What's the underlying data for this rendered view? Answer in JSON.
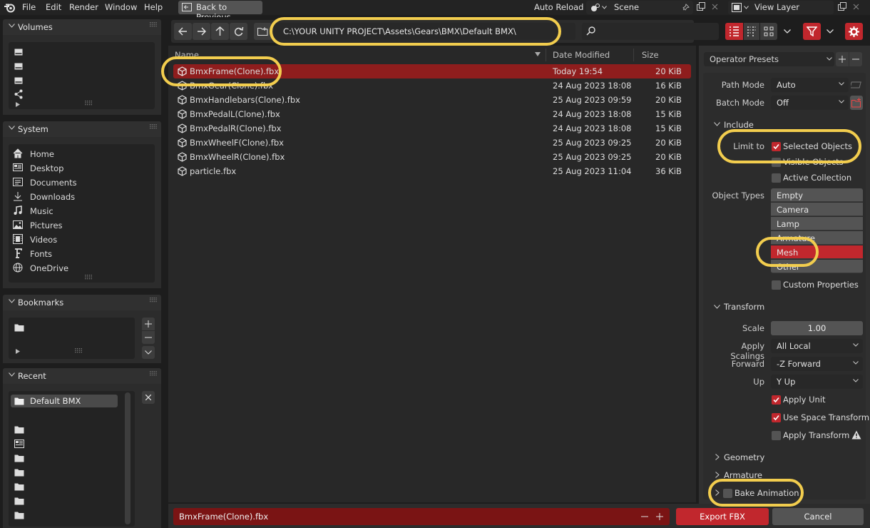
{
  "topbar": {
    "menus": [
      "File",
      "Edit",
      "Render",
      "Window",
      "Help"
    ],
    "back_label": "Back to Previous",
    "auto_reload": "Auto Reload",
    "scene": "Scene",
    "view_layer": "View Layer"
  },
  "sidebar": {
    "volumes_title": "Volumes",
    "system_title": "System",
    "system_items": [
      "Home",
      "Desktop",
      "Documents",
      "Downloads",
      "Music",
      "Pictures",
      "Videos",
      "Fonts",
      "OneDrive"
    ],
    "bookmarks_title": "Bookmarks",
    "recent_title": "Recent",
    "recent_items": [
      "Default BMX"
    ]
  },
  "browser": {
    "path": "C:\\YOUR UNITY PROJECT\\Assets\\Gears\\BMX\\Default BMX\\",
    "search_placeholder": "",
    "columns": {
      "name": "Name",
      "date": "Date Modified",
      "size": "Size"
    },
    "files": [
      {
        "name": "BmxFrame(Clone).fbx",
        "date": "Today 19:54",
        "size": "20 KiB"
      },
      {
        "name": "BmxGear(Clone).fbx",
        "date": "24 Aug 2023 18:08",
        "size": "16 KiB"
      },
      {
        "name": "BmxHandlebars(Clone).fbx",
        "date": "25 Aug 2023 09:59",
        "size": "20 KiB"
      },
      {
        "name": "BmxPedalL(Clone).fbx",
        "date": "24 Aug 2023 18:08",
        "size": "15 KiB"
      },
      {
        "name": "BmxPedalR(Clone).fbx",
        "date": "24 Aug 2023 18:08",
        "size": "15 KiB"
      },
      {
        "name": "BmxWheelF(Clone).fbx",
        "date": "25 Aug 2023 09:25",
        "size": "20 KiB"
      },
      {
        "name": "BmxWheelR(Clone).fbx",
        "date": "25 Aug 2023 09:25",
        "size": "20 KiB"
      },
      {
        "name": "particle.fbx",
        "date": "25 Aug 2023 11:04",
        "size": "36 KiB"
      }
    ],
    "filename": "BmxFrame(Clone).fbx",
    "export_label": "Export FBX",
    "cancel_label": "Cancel"
  },
  "options": {
    "presets": "Operator Presets",
    "path_mode_label": "Path Mode",
    "path_mode": "Auto",
    "batch_mode_label": "Batch Mode",
    "batch_mode": "Off",
    "include_title": "Include",
    "limit_to_label": "Limit to",
    "selected_objects": "Selected Objects",
    "visible_objects": "Visible Objects",
    "active_collection": "Active Collection",
    "object_types_label": "Object Types",
    "object_types": [
      "Empty",
      "Camera",
      "Lamp",
      "Armature",
      "Mesh",
      "Other"
    ],
    "custom_properties": "Custom Properties",
    "transform_title": "Transform",
    "scale_label": "Scale",
    "scale": "1.00",
    "apply_scalings_label": "Apply Scalings",
    "apply_scalings": "All Local",
    "forward_label": "Forward",
    "forward": "-Z Forward",
    "up_label": "Up",
    "up": "Y Up",
    "apply_unit": "Apply Unit",
    "use_space_transform": "Use Space Transform",
    "apply_transform": "Apply Transform",
    "geometry_title": "Geometry",
    "armature_title": "Armature",
    "bake_animation": "Bake Animation"
  },
  "colors": {
    "accent": "#c1272d",
    "highlight": "#f2cd4e",
    "selected_row": "#8f1d1d"
  }
}
